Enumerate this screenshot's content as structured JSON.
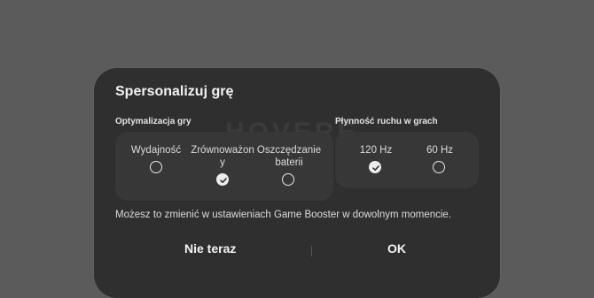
{
  "dialog": {
    "title": "Spersonalizuj grę",
    "optimization": {
      "label": "Optymalizacja gry",
      "options": [
        {
          "line1": "Wydajność",
          "line2": "",
          "checked": false
        },
        {
          "line1": "Zrównoważon",
          "line2": "y",
          "checked": true
        },
        {
          "line1": "Oszczędzanie",
          "line2": "baterii",
          "checked": false
        }
      ]
    },
    "smoothness": {
      "label": "Płynność ruchu w grach",
      "options": [
        {
          "line1": "120 Hz",
          "checked": true
        },
        {
          "line1": "60 Hz",
          "checked": false
        }
      ]
    },
    "info_text": "Możesz to zmienić w ustawieniach Game Booster w dowolnym momencie.",
    "buttons": {
      "cancel": "Nie teraz",
      "ok": "OK"
    }
  },
  "watermark": "HOVERE"
}
